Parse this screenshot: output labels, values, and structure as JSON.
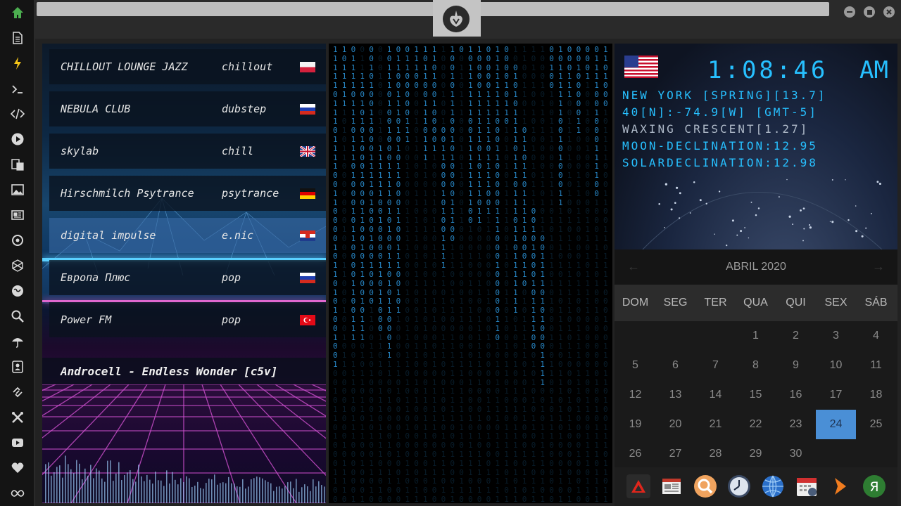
{
  "topbar": {
    "url": "",
    "emblem": "rebel-alliance-icon"
  },
  "sidebar": {
    "icons": [
      "home-icon",
      "document-icon",
      "lightning-icon",
      "terminal-icon",
      "code-icon",
      "play-icon",
      "translate-icon",
      "image-icon",
      "news-icon",
      "settings-icon",
      "hexagon-icon",
      "globe-icon",
      "search-icon",
      "umbrella-icon",
      "contact-icon",
      "link-icon",
      "tools-icon",
      "youtube-icon",
      "heart-icon",
      "infinity-icon"
    ]
  },
  "stations": [
    {
      "name": "CHILLOUT LOUNGE JAZZ",
      "genre": "chillout",
      "flag": "poland"
    },
    {
      "name": "NEBULA CLUB",
      "genre": "dubstep",
      "flag": "russia"
    },
    {
      "name": "skylab",
      "genre": "chill",
      "flag": "uk"
    },
    {
      "name": "Hirschmilch Psytrance",
      "genre": "psytrance",
      "flag": "germany"
    },
    {
      "name": "digital impulse",
      "genre": "e.nic",
      "flag": "croatia"
    },
    {
      "name": "Европа Плюс",
      "genre": "pop",
      "flag": "russia"
    },
    {
      "name": "Power FM",
      "genre": "pop",
      "flag": "turkey"
    }
  ],
  "now_playing": "Androcell - Endless Wonder [c5v]",
  "clock": {
    "time": "1:08:46",
    "ampm": "AM",
    "line1": "NEW YORK [SPRING][13.7]",
    "line2": "40[N]:-74.9[W] [GMT-5]",
    "line3": "WAXING CRESCENT[1.27]",
    "line4": "MOON-DECLINATION:12.95",
    "line5": "SOLARDECLINATION:12.98"
  },
  "calendar": {
    "month": "ABRIL 2020",
    "weekdays": [
      "DOM",
      "SEG",
      "TER",
      "QUA",
      "QUI",
      "SEX",
      "SÁB"
    ],
    "days": [
      [
        "",
        "",
        "",
        "1",
        "2",
        "3",
        "4"
      ],
      [
        "5",
        "6",
        "7",
        "8",
        "9",
        "10",
        "11"
      ],
      [
        "12",
        "13",
        "14",
        "15",
        "16",
        "17",
        "18"
      ],
      [
        "19",
        "20",
        "21",
        "22",
        "23",
        "24",
        "25"
      ],
      [
        "26",
        "27",
        "28",
        "29",
        "30",
        "",
        ""
      ]
    ],
    "today": "24"
  },
  "dock": [
    "anydesk-icon",
    "news-reader-icon",
    "search-icon",
    "clock-icon",
    "browser-icon",
    "calendar-icon",
    "arrow-icon",
    "yandex-icon"
  ],
  "colors": {
    "accent": "#4a8fd6",
    "lcd": "#27c0ff",
    "matrix": "#2a8ed0"
  }
}
